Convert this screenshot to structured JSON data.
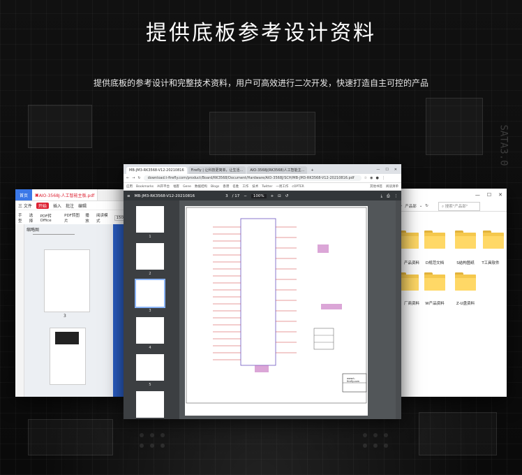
{
  "header": {
    "title": "提供底板参考设计资料",
    "subtitle": "提供底板的参考设计和完整技术资料，用户可高效进行二次开发，快速打造自主可控的产品"
  },
  "background": {
    "silkscreen": "SATA3.0"
  },
  "left_window": {
    "home_tab": "首页",
    "doc_tab": "AIO-3568J-人工智能主板.pdf",
    "menu": [
      "三 文件",
      "开始",
      "插入",
      "批注",
      "编辑"
    ],
    "active_menu": "开始",
    "tools": [
      "手型",
      "选择",
      "PDF转Office",
      "PDF转图片",
      "播放",
      "阅读模式"
    ],
    "zoom": "150",
    "panel_title": "缩略图",
    "page_label": "3"
  },
  "main_window": {
    "tabs": [
      "MB-JM3-RK3568-V12-20210816",
      "Firefly | 让科技更简单，让生活...",
      "AIO-3568J(RK3568)人工智能主..."
    ],
    "url": "download.t-firefly.com/product/Board/RK3568/Document/Hardware/AIO-3568J/SCH/MB-JM3-RK3568-V12-20210816.pdf",
    "bookmarks": [
      "应用",
      "Bookmarks",
      "AI开平台",
      "福客",
      "Gene",
      "数据结构",
      "Blogs",
      "香港",
      "名胜",
      "工作",
      "技术",
      "Twitter",
      "一周工作",
      "cOPTER",
      "其他书签",
      "阅读清单"
    ],
    "pdf_title": "MB-JM3-RK3568-V12-20210816",
    "page_current": "3",
    "page_total": "/ 17",
    "zoom": "100%",
    "thumbnail_pages": [
      "1",
      "2",
      "3",
      "4",
      "5",
      "6"
    ],
    "brand_mark": "www.t-firefly.com"
  },
  "right_window": {
    "breadcrumb": "产品部",
    "search_placeholder": "搜索\"产品部\"",
    "folders": [
      "产品资料",
      "D规范文档",
      "S结构图纸",
      "T工具软件",
      "厂商资料",
      "W产品资料",
      "Z-U盘资料"
    ]
  },
  "colors": {
    "accent_blue": "#3b78e7",
    "wps_red": "#dd2233",
    "pdf_toolbar": "#323639",
    "folder_yellow": "#f5c84d"
  }
}
